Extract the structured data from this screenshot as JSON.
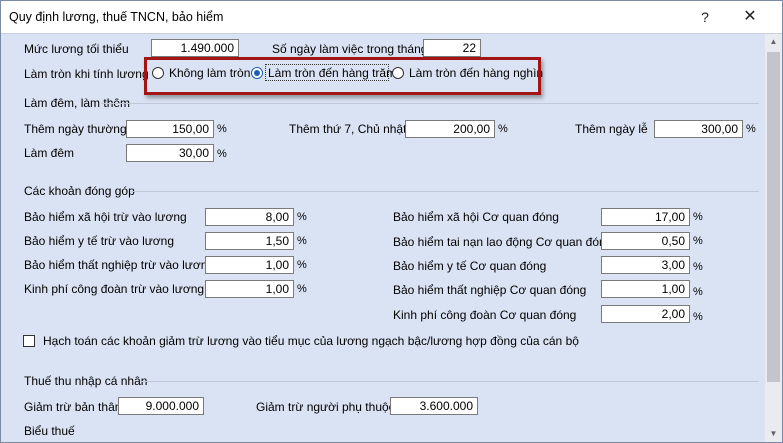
{
  "window": {
    "title": "Quy định lương, thuế TNCN, bảo hiểm",
    "help_label": "?",
    "close_label": "✕"
  },
  "top": {
    "min_salary_label": "Mức lương tối thiểu",
    "min_salary_value": "1.490.000",
    "workdays_label": "Số ngày làm việc trong tháng",
    "workdays_value": "22",
    "rounding_label": "Làm tròn khi tính lương",
    "rounding_options": [
      {
        "label": "Không làm tròn",
        "selected": false
      },
      {
        "label": "Làm tròn đến hàng trăm",
        "selected": true
      },
      {
        "label": "Làm tròn đến hàng nghìn",
        "selected": false
      }
    ]
  },
  "overtime": {
    "title": "Làm đêm, làm thêm",
    "weekday_label": "Thêm ngày thường",
    "weekday_value": "150,00",
    "weekend_label": "Thêm thứ 7, Chủ nhật",
    "weekend_value": "200,00",
    "holiday_label": "Thêm ngày lễ",
    "holiday_value": "300,00",
    "night_label": "Làm đêm",
    "night_value": "30,00",
    "percent": "%"
  },
  "contributions": {
    "title": "Các khoản đóng góp",
    "employee": [
      {
        "label": "Bảo hiểm xã hội trừ vào lương",
        "value": "8,00"
      },
      {
        "label": "Bảo hiểm y tế trừ vào lương",
        "value": "1,50"
      },
      {
        "label": "Bảo hiểm thất nghiệp trừ vào lương",
        "value": "1,00"
      },
      {
        "label": "Kinh phí công đoàn trừ vào lương",
        "value": "1,00"
      }
    ],
    "agency": [
      {
        "label": "Bảo hiểm xã hội Cơ quan đóng",
        "value": "17,00"
      },
      {
        "label": "Bảo hiểm tai nạn lao động Cơ quan đóng",
        "value": "0,50"
      },
      {
        "label": "Bảo hiểm y tế Cơ quan đóng",
        "value": "3,00"
      },
      {
        "label": "Bảo hiểm thất nghiệp Cơ quan đóng",
        "value": "1,00"
      },
      {
        "label": "Kinh phí công đoàn Cơ quan đóng",
        "value": "2,00"
      }
    ],
    "percent": "%",
    "checkbox_label": "Hạch toán các khoản giảm trừ lương vào tiểu mục của lương ngạch bậc/lương hợp đồng của cán bộ",
    "checkbox_checked": false
  },
  "tax": {
    "title": "Thuế thu nhập cá nhân",
    "personal_label": "Giảm trừ bản thân",
    "personal_value": "9.000.000",
    "dependent_label": "Giảm trừ người phụ thuộc",
    "dependent_value": "3.600.000",
    "table_label": "Biểu thuế"
  },
  "colors": {
    "background": "#dae3f3",
    "highlight": "#a31515",
    "radio_selected": "#1a5fb4"
  }
}
